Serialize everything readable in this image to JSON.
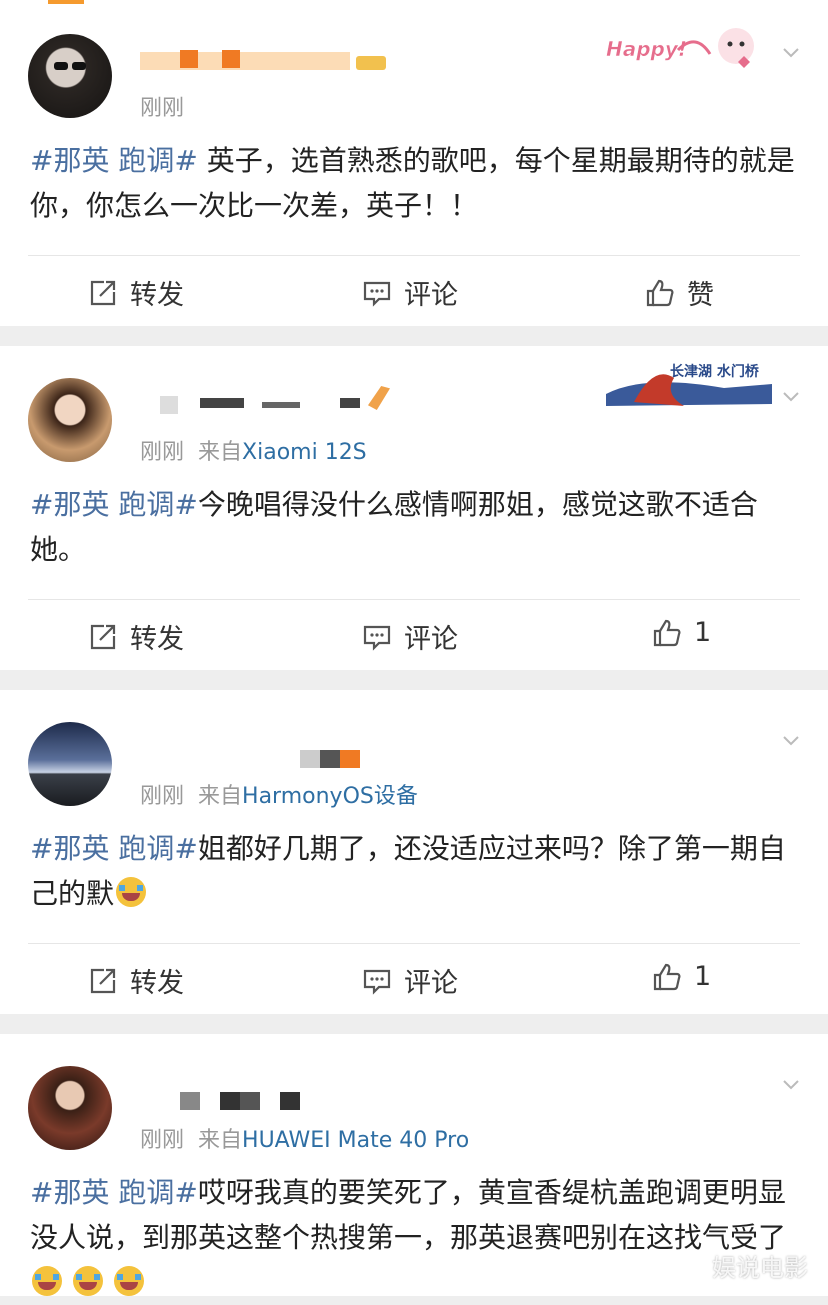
{
  "posts": [
    {
      "time": "刚刚",
      "source_prefix": "",
      "device": "",
      "tag": "#那英 跑调#",
      "text": " 英子，选首熟悉的歌吧，每个星期最期待的就是你，你怎么一次比一次差，英子！！",
      "badge_text": "Happy!",
      "actions": {
        "repost": "转发",
        "comment": "评论",
        "like": "赞"
      }
    },
    {
      "time": "刚刚",
      "source_prefix": "来自",
      "device": "Xiaomi 12S",
      "tag": "#那英 跑调#",
      "text": "今晚唱得没什么感情啊那姐，感觉这歌不适合她。",
      "badge_text": "长津湖 水门桥",
      "actions": {
        "repost": "转发",
        "comment": "评论",
        "like": "1"
      }
    },
    {
      "time": "刚刚",
      "source_prefix": "来自",
      "device": "HarmonyOS设备",
      "tag": "#那英 跑调#",
      "text": "姐都好几期了，还没适应过来吗？除了第一期自己的默",
      "actions": {
        "repost": "转发",
        "comment": "评论",
        "like": "1"
      }
    },
    {
      "time": "刚刚",
      "source_prefix": "来自",
      "device": "HUAWEI Mate 40 Pro",
      "tag": "#那英 跑调#",
      "text": "哎呀我真的要笑死了，黄宣香缇杭盖跑调更明显没人说，到那英这整个热搜第一，那英退赛吧别在这找气受了",
      "actions": {}
    }
  ],
  "watermark": "娱说电影",
  "colors": {
    "tag": "#4a6fa0",
    "device": "#2e6ea3",
    "meta": "#999999",
    "background": "#eeeeee"
  }
}
